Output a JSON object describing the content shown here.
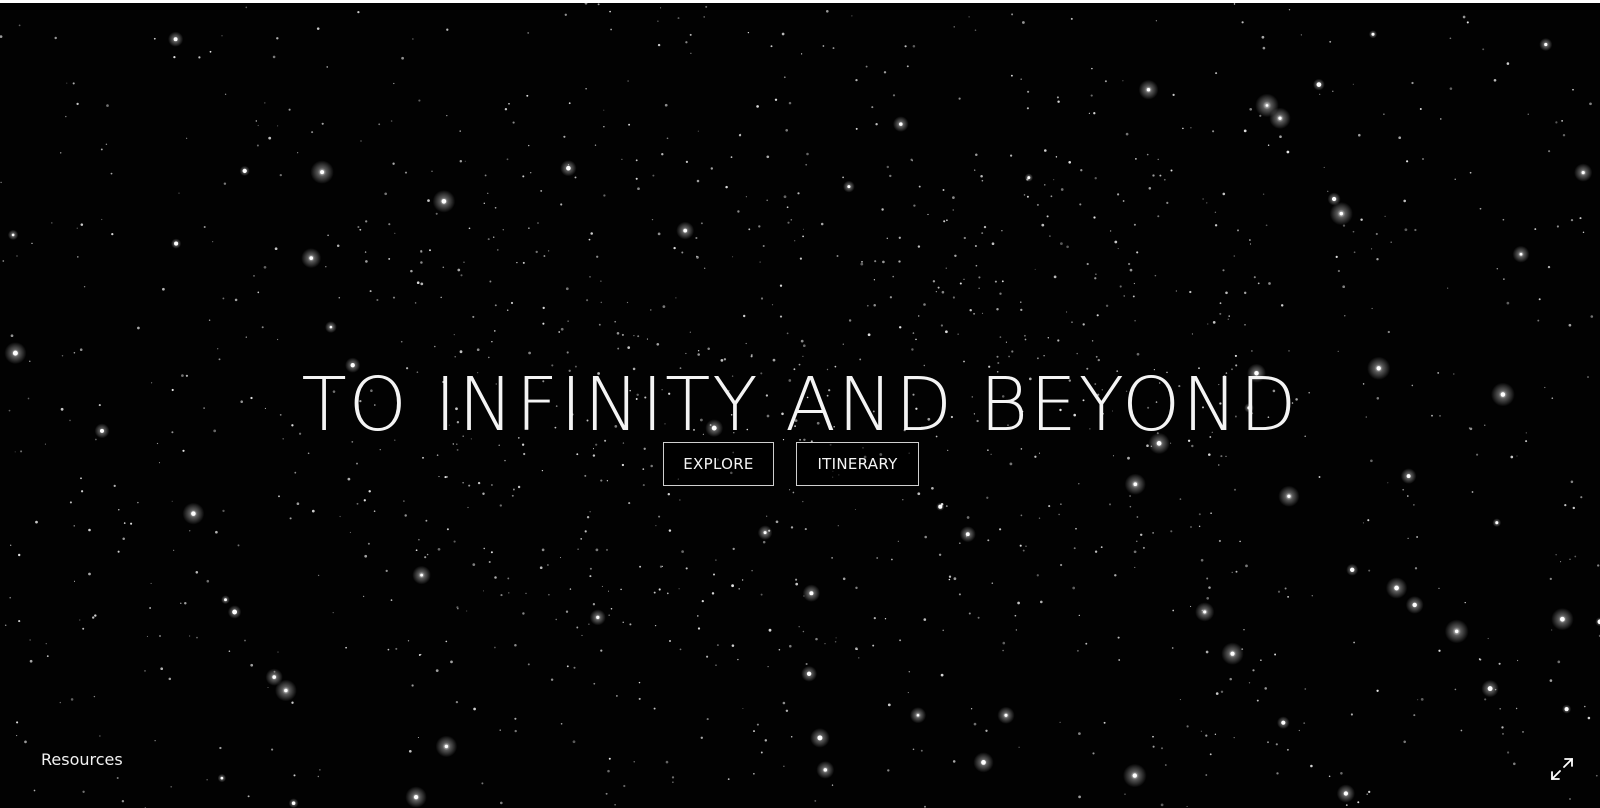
{
  "hero": {
    "title": "TO INFINITY AND BEYOND"
  },
  "buttons": {
    "explore_label": "EXPLORE",
    "itinerary_label": "ITINERARY"
  },
  "footer": {
    "resources_label": "Resources",
    "fullscreen_icon": "expand-arrows-icon"
  },
  "colors": {
    "background": "#020202",
    "star": "#ffffff",
    "text": "#f4f4f4",
    "button_border": "#cfcfcf"
  }
}
